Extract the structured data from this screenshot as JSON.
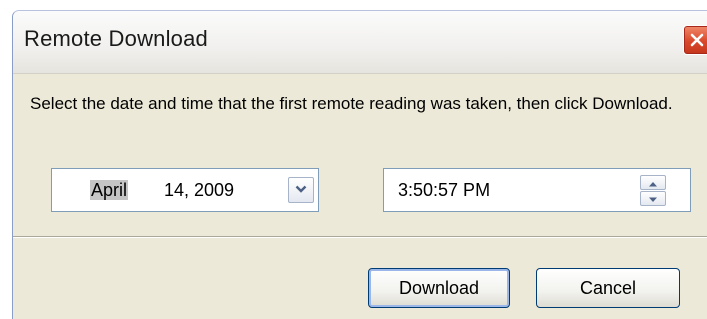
{
  "window": {
    "title": "Remote Download",
    "close_icon": "close-icon"
  },
  "dialog": {
    "message": "Select the date and time that the first remote reading was taken, then click Download."
  },
  "date_picker": {
    "month": "April",
    "day_year": "14, 2009",
    "dropdown_icon": "chevron-down-icon"
  },
  "time_picker": {
    "value": "3:50:57 PM",
    "up_icon": "arrow-up-icon",
    "down_icon": "arrow-down-icon"
  },
  "buttons": {
    "download_label": "Download",
    "cancel_label": "Cancel"
  },
  "colors": {
    "dialog_background": "#ece9d8",
    "close_button": "#d9482a",
    "field_border": "#7f9db9",
    "button_border": "#003c74",
    "month_highlight": "#c5c5c5"
  }
}
